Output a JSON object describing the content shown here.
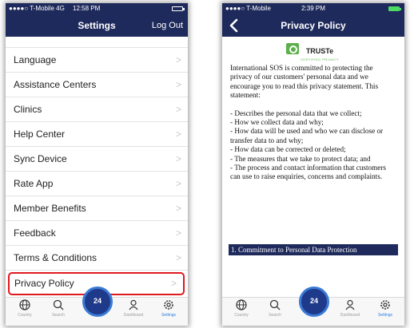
{
  "left_screen": {
    "status": {
      "carrier": "●●●●○ T-Mobile 4G",
      "time": "12:58 PM"
    },
    "nav": {
      "title": "Settings",
      "logout_label": "Log Out"
    },
    "settings_items": [
      {
        "label": "Language"
      },
      {
        "label": "Assistance Centers"
      },
      {
        "label": "Clinics"
      },
      {
        "label": "Help Center"
      },
      {
        "label": "Sync Device"
      },
      {
        "label": "Rate App"
      },
      {
        "label": "Member Benefits"
      },
      {
        "label": "Feedback"
      },
      {
        "label": "Terms & Conditions"
      },
      {
        "label": "Privacy Policy"
      }
    ],
    "highlight_color": "#e0191f"
  },
  "right_screen": {
    "status": {
      "carrier": "●●●●○ T-Mobile",
      "time": "2:39 PM"
    },
    "nav": {
      "title": "Privacy Policy"
    },
    "truste": {
      "name": "TRUSTe",
      "tagline": "CERTIFIED PRIVACY"
    },
    "policy_paragraphs": [
      "International SOS is committed to protecting the privacy of our customers' personal data and we encourage you to read this privacy statement. This statement:",
      "- Describes the personal data that we collect;",
      "- How we collect data and why;",
      "- How data will be used and who we can disclose or transfer data to and why;",
      "- How data can be corrected or deleted;",
      "- The measures that we take to protect data; and",
      "- The process and contact information that customers can use to raise enquiries, concerns and complaints."
    ],
    "section_heading": "1. Commitment to Personal Data Protection"
  },
  "tabbar": {
    "items": [
      {
        "label": "Country",
        "icon": "globe-icon"
      },
      {
        "label": "Search",
        "icon": "search-icon"
      },
      {
        "label": "24",
        "icon": "phone-24-icon"
      },
      {
        "label": "Dashboard",
        "icon": "person-icon"
      },
      {
        "label": "Settings",
        "icon": "gear-icon"
      }
    ],
    "active_color": "#2a7de1"
  },
  "colors": {
    "nav_background": "#1f2a5c",
    "call_button": "#1f3a8a"
  }
}
